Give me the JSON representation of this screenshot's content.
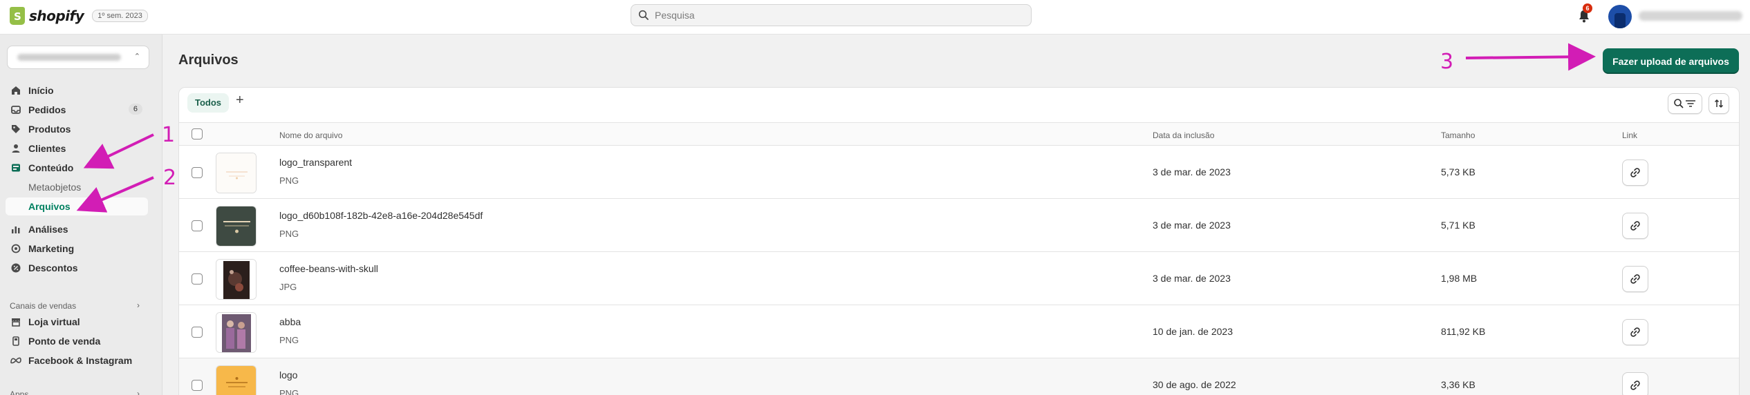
{
  "app": {
    "brand": "shopify",
    "edition": "1º sem. 2023",
    "brand_color": "#95bf47",
    "accent_color": "#0d6e57"
  },
  "topbar": {
    "search_placeholder": "Pesquisa",
    "notification_count": "6"
  },
  "sidebar": {
    "nav": [
      {
        "label": "Início",
        "icon": "home-icon"
      },
      {
        "label": "Pedidos",
        "icon": "inbox-icon",
        "count": "6"
      },
      {
        "label": "Produtos",
        "icon": "tag-icon"
      },
      {
        "label": "Clientes",
        "icon": "person-icon"
      },
      {
        "label": "Conteúdo",
        "icon": "content-icon"
      },
      {
        "label": "Metaobjetos"
      },
      {
        "label": "Arquivos"
      },
      {
        "label": "Análises",
        "icon": "bar-chart-icon"
      },
      {
        "label": "Marketing",
        "icon": "target-icon"
      },
      {
        "label": "Descontos",
        "icon": "discount-icon"
      }
    ],
    "sales_channels_header": "Canais de vendas",
    "channels": [
      {
        "label": "Loja virtual",
        "icon": "store-icon"
      },
      {
        "label": "Ponto de venda",
        "icon": "pos-icon"
      },
      {
        "label": "Facebook & Instagram",
        "icon": "meta-icon"
      }
    ],
    "apps_header": "Apps"
  },
  "main": {
    "title": "Arquivos",
    "upload_button": "Fazer upload de arquivos",
    "tabs": [
      {
        "label": "Todos"
      }
    ],
    "columns": {
      "name": "Nome do arquivo",
      "date": "Data da inclusão",
      "size": "Tamanho",
      "link": "Link"
    },
    "rows": [
      {
        "name": "logo_transparent",
        "type": "PNG",
        "date": "3 de mar. de 2023",
        "size": "5,73 KB"
      },
      {
        "name": "logo_d60b108f-182b-42e8-a16e-204d28e545df",
        "type": "PNG",
        "date": "3 de mar. de 2023",
        "size": "5,71 KB"
      },
      {
        "name": "coffee-beans-with-skull",
        "type": "JPG",
        "date": "3 de mar. de 2023",
        "size": "1,98 MB"
      },
      {
        "name": "abba",
        "type": "PNG",
        "date": "10 de jan. de 2023",
        "size": "811,92 KB"
      },
      {
        "name": "logo",
        "type": "PNG",
        "date": "30 de ago. de 2022",
        "size": "3,36 KB"
      }
    ]
  },
  "annotations": {
    "marker_1": "1",
    "marker_2": "2",
    "marker_3": "3",
    "color": "#d21db5"
  }
}
